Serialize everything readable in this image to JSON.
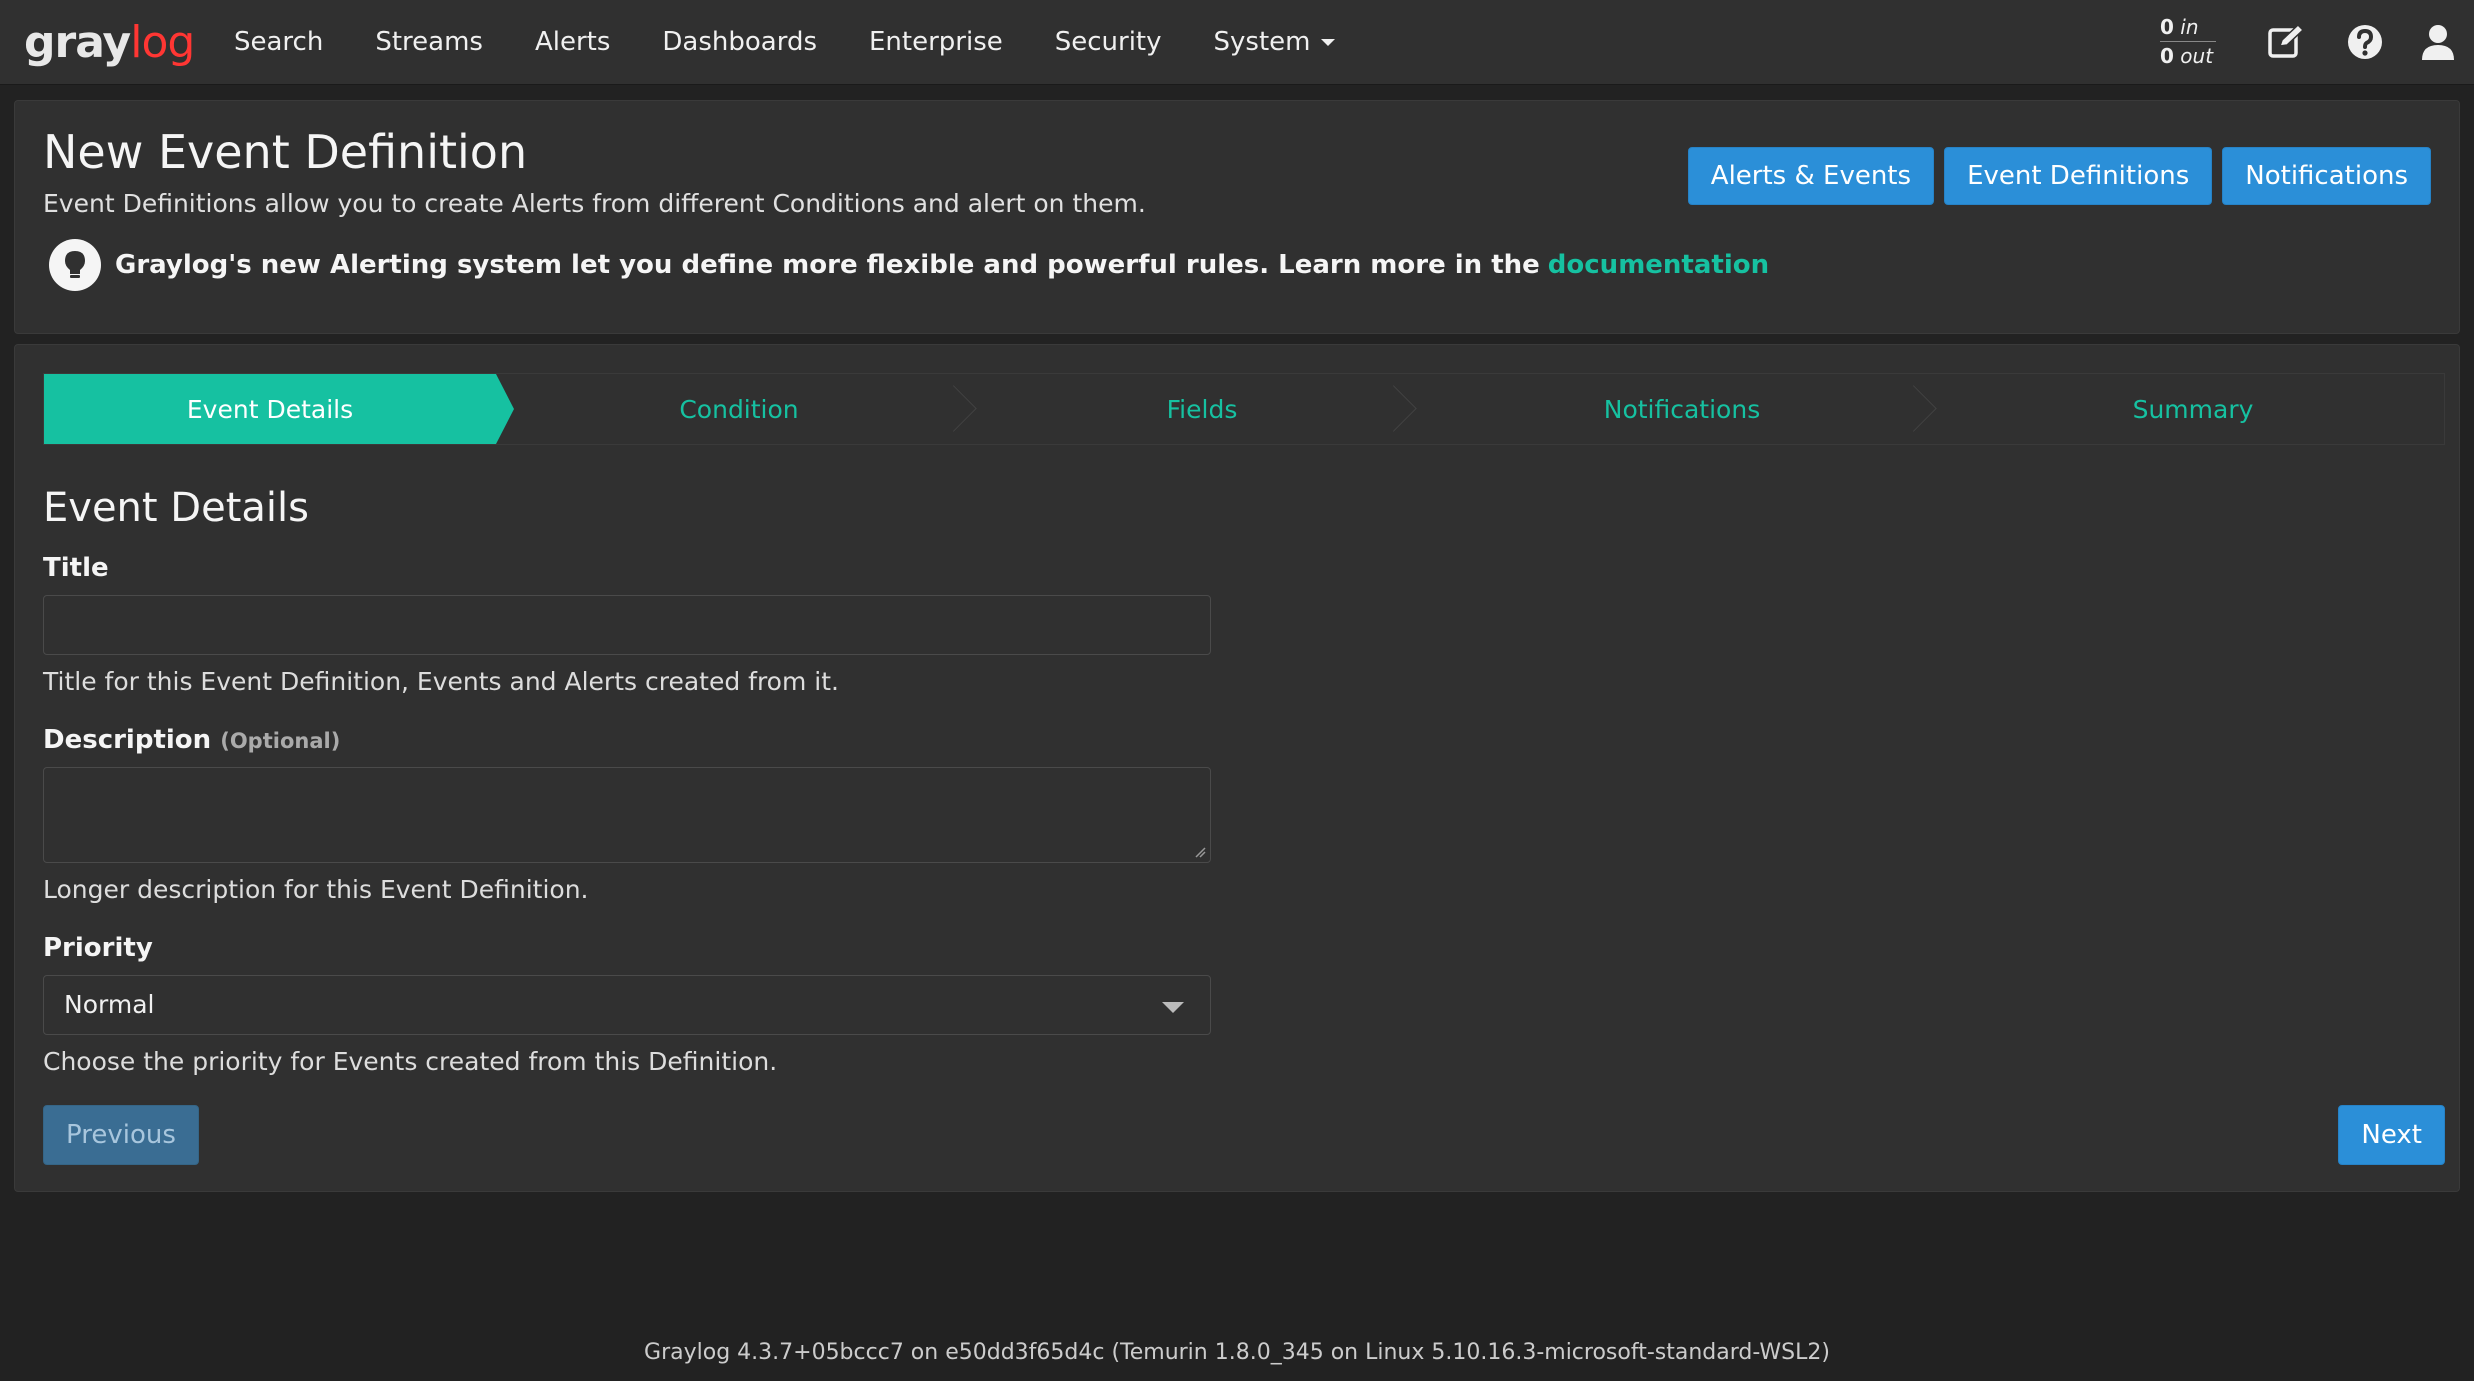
{
  "navbar": {
    "logo_text_gray": "gray",
    "logo_text_log": "log",
    "items": [
      {
        "label": "Search"
      },
      {
        "label": "Streams"
      },
      {
        "label": "Alerts"
      },
      {
        "label": "Dashboards"
      },
      {
        "label": "Enterprise"
      },
      {
        "label": "Security"
      },
      {
        "label": "System"
      }
    ],
    "throughput": {
      "in_count": "0",
      "in_label": "in",
      "out_count": "0",
      "out_label": "out"
    },
    "icons": [
      "edit-icon",
      "help-icon",
      "user-icon"
    ]
  },
  "header": {
    "title": "New Event Definition",
    "description": "Event Definitions allow you to create Alerts from different Conditions and alert on them.",
    "tip_text": "Graylog's new Alerting system let you define more flexible and powerful rules. Learn more in the",
    "tip_link": "documentation",
    "buttons": {
      "alerts_events": "Alerts & Events",
      "event_definitions": "Event Definitions",
      "notifications": "Notifications"
    }
  },
  "wizard": {
    "steps": [
      {
        "label": "Event Details",
        "active": true
      },
      {
        "label": "Condition",
        "active": false
      },
      {
        "label": "Fields",
        "active": false
      },
      {
        "label": "Notifications",
        "active": false
      },
      {
        "label": "Summary",
        "active": false
      }
    ]
  },
  "form": {
    "section_title": "Event Details",
    "title_label": "Title",
    "title_value": "",
    "title_help": "Title for this Event Definition, Events and Alerts created from it.",
    "description_label": "Description",
    "description_optional": "(Optional)",
    "description_value": "",
    "description_help": "Longer description for this Event Definition.",
    "priority_label": "Priority",
    "priority_value": "Normal",
    "priority_help": "Choose the priority for Events created from this Definition.",
    "previous_label": "Previous",
    "next_label": "Next"
  },
  "footer": {
    "text": "Graylog 4.3.7+05bccc7 on e50dd3f65d4c (Temurin 1.8.0_345 on Linux 5.10.16.3-microsoft-standard-WSL2)"
  },
  "colors": {
    "accent": "#16c1a1",
    "primary_button": "#2b8fd8",
    "logo_red": "#ff3633",
    "background": "#222222",
    "panel": "#303030"
  }
}
